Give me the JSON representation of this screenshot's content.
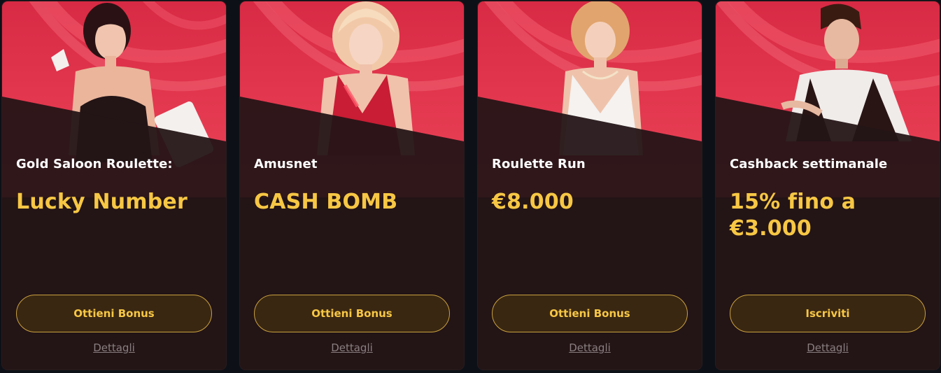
{
  "colors": {
    "background": "#0d1117",
    "card": "#231416",
    "banner": "#e8394f",
    "accent_gold": "#f7c744",
    "button_bg": "#3a2712",
    "button_border": "#c9a23e",
    "details_text": "#8a7f80"
  },
  "cards": [
    {
      "illustration": "woman-dark-hair-holding-cards",
      "subtitle": "Gold Saloon Roulette:",
      "headline": "Lucky Number",
      "button_label": "Ottieni Bonus",
      "details_label": "Dettagli"
    },
    {
      "illustration": "woman-blonde-red-dress",
      "subtitle": "Amusnet",
      "headline": "CASH BOMB",
      "button_label": "Ottieni Bonus",
      "details_label": "Dettagli"
    },
    {
      "illustration": "woman-blonde-white-dress",
      "subtitle": "Roulette Run",
      "headline": "€8.000",
      "button_label": "Ottieni Bonus",
      "details_label": "Dettagli"
    },
    {
      "illustration": "man-dealer-vest",
      "subtitle": "Cashback settimanale",
      "headline": "15% fino a €3.000",
      "button_label": "Iscriviti",
      "details_label": "Dettagli"
    }
  ]
}
